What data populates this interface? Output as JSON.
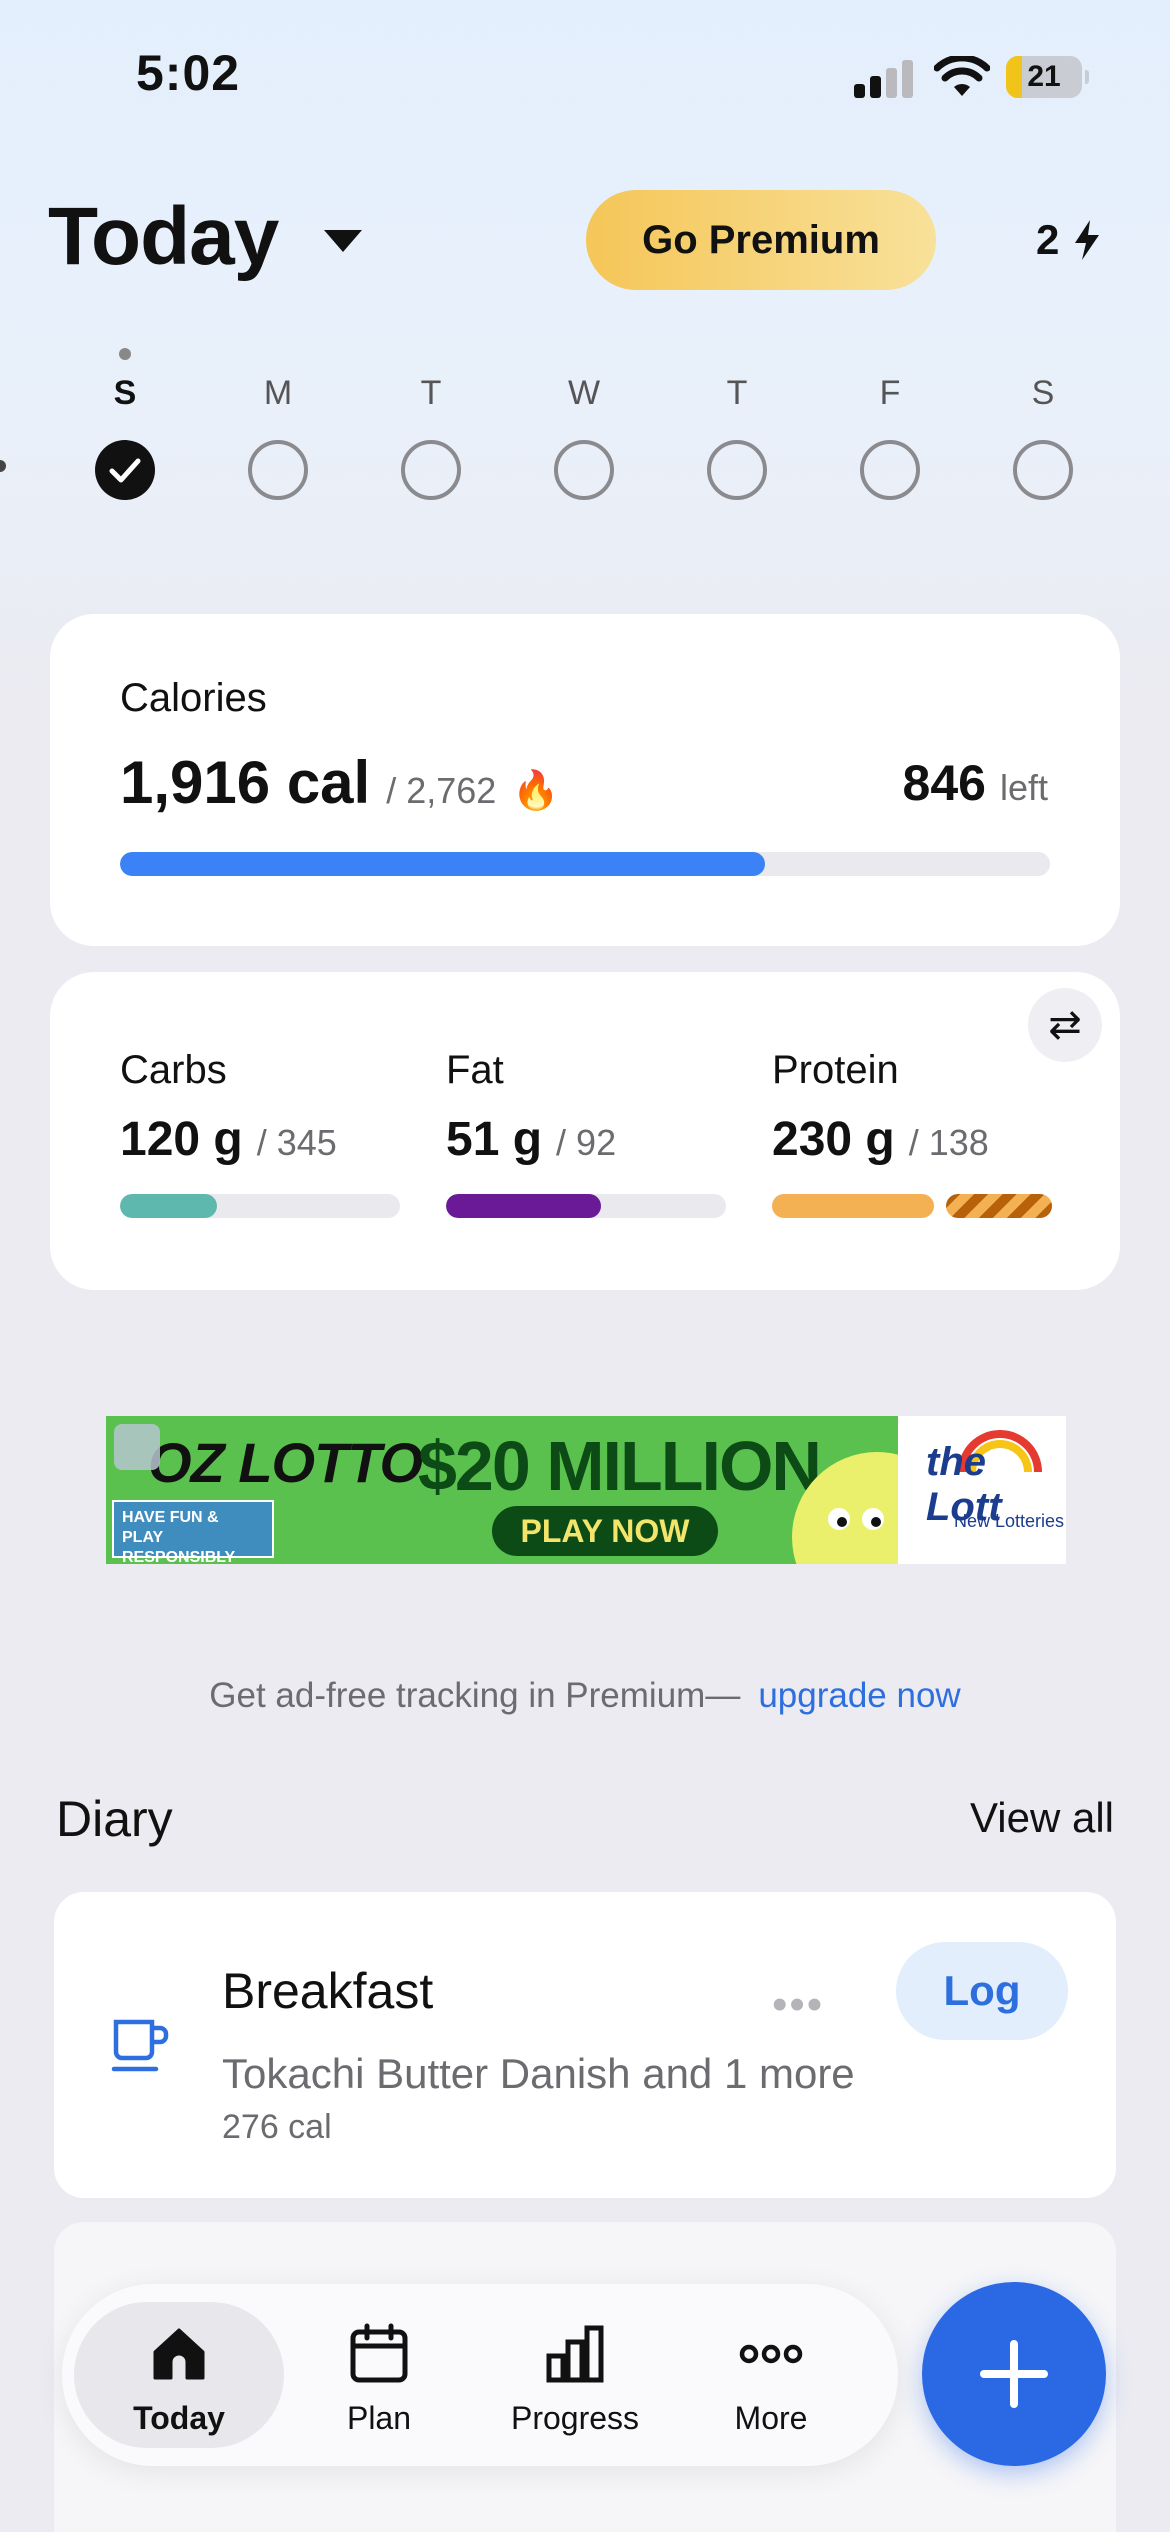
{
  "status_bar": {
    "time": "5:02",
    "battery": "21",
    "battery_level": 0.21
  },
  "header": {
    "title": "Today",
    "premium_label": "Go Premium",
    "streak_count": "2",
    "streak_icon": "bolt-icon"
  },
  "week": [
    {
      "letter": "S",
      "done": true,
      "today": true
    },
    {
      "letter": "M",
      "done": false
    },
    {
      "letter": "T",
      "done": false
    },
    {
      "letter": "W",
      "done": false
    },
    {
      "letter": "T",
      "done": false
    },
    {
      "letter": "F",
      "done": false
    },
    {
      "letter": "S",
      "done": false
    }
  ],
  "calories": {
    "label": "Calories",
    "consumed": "1,916 cal",
    "goal": "/ 2,762",
    "left_value": "846",
    "left_label": "left",
    "progress": 0.694,
    "color": "#3b82f6"
  },
  "macros": [
    {
      "name": "Carbs",
      "amount": "120 g",
      "goal": "/ 345",
      "progress": 0.348,
      "color": "#5fb8ae"
    },
    {
      "name": "Fat",
      "amount": "51 g",
      "goal": "/ 92",
      "progress": 0.554,
      "color": "#6a1a96"
    },
    {
      "name": "Protein",
      "amount": "230 g",
      "goal": "/ 138",
      "progress": 1.667,
      "color": "#f3b154"
    }
  ],
  "ad": {
    "brand": "OZ LOTTO",
    "headline": "$20 MILLION",
    "cta": "PLAY NOW",
    "note": "HAVE FUN & PLAY RESPONSIBLY",
    "logo": "the Lott",
    "logo_sub": "New Lotteries"
  },
  "premium_promo": {
    "text": "Get ad-free tracking in Premium—",
    "link": "upgrade now"
  },
  "diary": {
    "title": "Diary",
    "view_all": "View all",
    "meals": [
      {
        "name": "Breakfast",
        "foods": "Tokachi Butter Danish and 1 more",
        "calories": "276 cal",
        "log_label": "Log",
        "icon": "mug-icon"
      }
    ]
  },
  "tab_bar": [
    {
      "label": "Today",
      "icon": "home-icon",
      "active": true
    },
    {
      "label": "Plan",
      "icon": "calendar-icon",
      "active": false
    },
    {
      "label": "Progress",
      "icon": "bar-chart-icon",
      "active": false
    },
    {
      "label": "More",
      "icon": "more-dots-icon",
      "active": false
    }
  ],
  "fab": {
    "icon": "plus-icon"
  }
}
